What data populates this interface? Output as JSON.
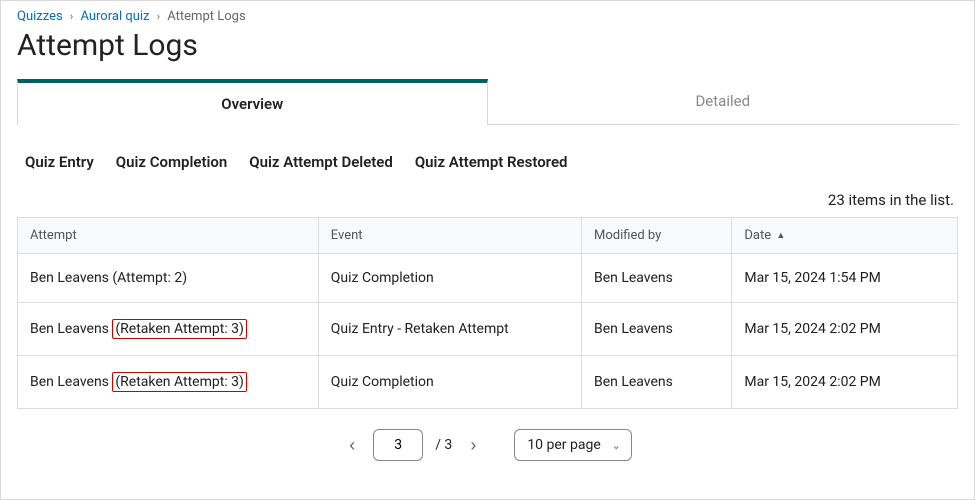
{
  "breadcrumb": {
    "root": "Quizzes",
    "parent": "Auroral quiz",
    "current": "Attempt Logs"
  },
  "page_title": "Attempt Logs",
  "tabs": {
    "overview": "Overview",
    "detailed": "Detailed"
  },
  "filters": {
    "entry": "Quiz Entry",
    "completion": "Quiz Completion",
    "deleted": "Quiz Attempt Deleted",
    "restored": "Quiz Attempt Restored"
  },
  "items_count": "23 items in the list.",
  "headers": {
    "attempt": "Attempt",
    "event": "Event",
    "modified_by": "Modified by",
    "date": "Date"
  },
  "rows": [
    {
      "attempt_prefix": "Ben Leavens ",
      "attempt_suffix": "(Attempt: 2)",
      "highlight": false,
      "event": "Quiz Completion",
      "modified_by": "Ben Leavens",
      "date": "Mar 15, 2024 1:54 PM"
    },
    {
      "attempt_prefix": "Ben Leavens ",
      "attempt_suffix": "(Retaken Attempt: 3)",
      "highlight": true,
      "event": "Quiz Entry - Retaken Attempt",
      "modified_by": "Ben Leavens",
      "date": "Mar 15, 2024 2:02 PM"
    },
    {
      "attempt_prefix": "Ben Leavens ",
      "attempt_suffix": "(Retaken Attempt: 3)",
      "highlight": true,
      "event": "Quiz Completion",
      "modified_by": "Ben Leavens",
      "date": "Mar 15, 2024 2:02 PM"
    }
  ],
  "pagination": {
    "current_page": "3",
    "total_pages": "/ 3",
    "per_page_label": "10 per page"
  }
}
